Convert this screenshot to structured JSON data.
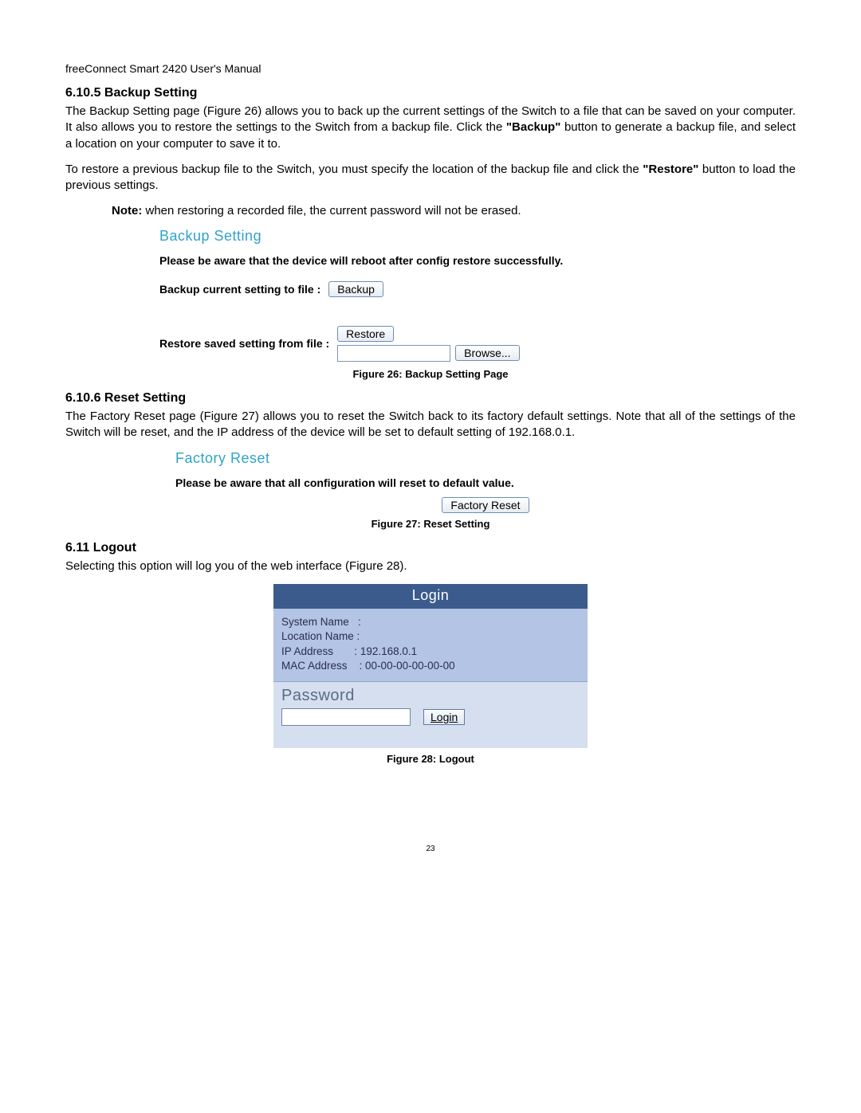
{
  "header": "freeConnect Smart 2420 User's Manual",
  "page_number": "23",
  "sections": {
    "s1_heading": "6.10.5 Backup Setting",
    "s1_p1a": "The Backup Setting page (Figure 26) allows you to back up the current settings of the Switch to a file that can be saved on your computer.  It also allows you to restore the settings to the Switch from a backup file.   Click the ",
    "s1_p1_bold1": "\"Backup\"",
    "s1_p1b": " button to generate a backup file, and select a location on your computer to save it to.",
    "s1_p2a": "To restore a previous backup file to the Switch, you must specify the location of the backup file and click the ",
    "s1_p2_bold": "\"Restore\"",
    "s1_p2b": " button to load the previous settings.",
    "s1_note_label": "Note:",
    "s1_note_text": " when restoring a recorded file, the current password will not be erased.",
    "s2_heading": "6.10.6 Reset Setting",
    "s2_p1": "The Factory Reset page (Figure 27) allows you to reset the Switch back to its factory default settings.  Note that all of the settings of the Switch will be reset, and the IP address of the device will be set to default setting of 192.168.0.1.",
    "s3_heading": "6.11  Logout",
    "s3_p1": "Selecting this option will log you of the web interface (Figure 28)."
  },
  "fig26": {
    "title": "Backup Setting",
    "warn": "Please be aware that the device will reboot after config restore successfully.",
    "row1_label": "Backup current setting to file :",
    "row1_btn": "Backup",
    "row2_label": "Restore saved setting from file :",
    "row2_restore_btn": "Restore",
    "row2_browse_btn": "Browse...",
    "caption": "Figure 26: Backup Setting Page"
  },
  "fig27": {
    "title": "Factory Reset",
    "warn": "Please be aware that all configuration will reset to default value.",
    "btn": "Factory Reset",
    "caption": "Figure 27: Reset Setting"
  },
  "fig28": {
    "login_title": "Login",
    "sysname_label": "System Name   :",
    "sysname_val": "",
    "locname_label": "Location Name :",
    "locname_val": "",
    "ip_label": "IP Address       : ",
    "ip_val": "192.168.0.1",
    "mac_label": "MAC Address    : ",
    "mac_val": "00-00-00-00-00-00",
    "pw_label": "Password",
    "login_btn": "Login",
    "caption": "Figure 28: Logout"
  }
}
